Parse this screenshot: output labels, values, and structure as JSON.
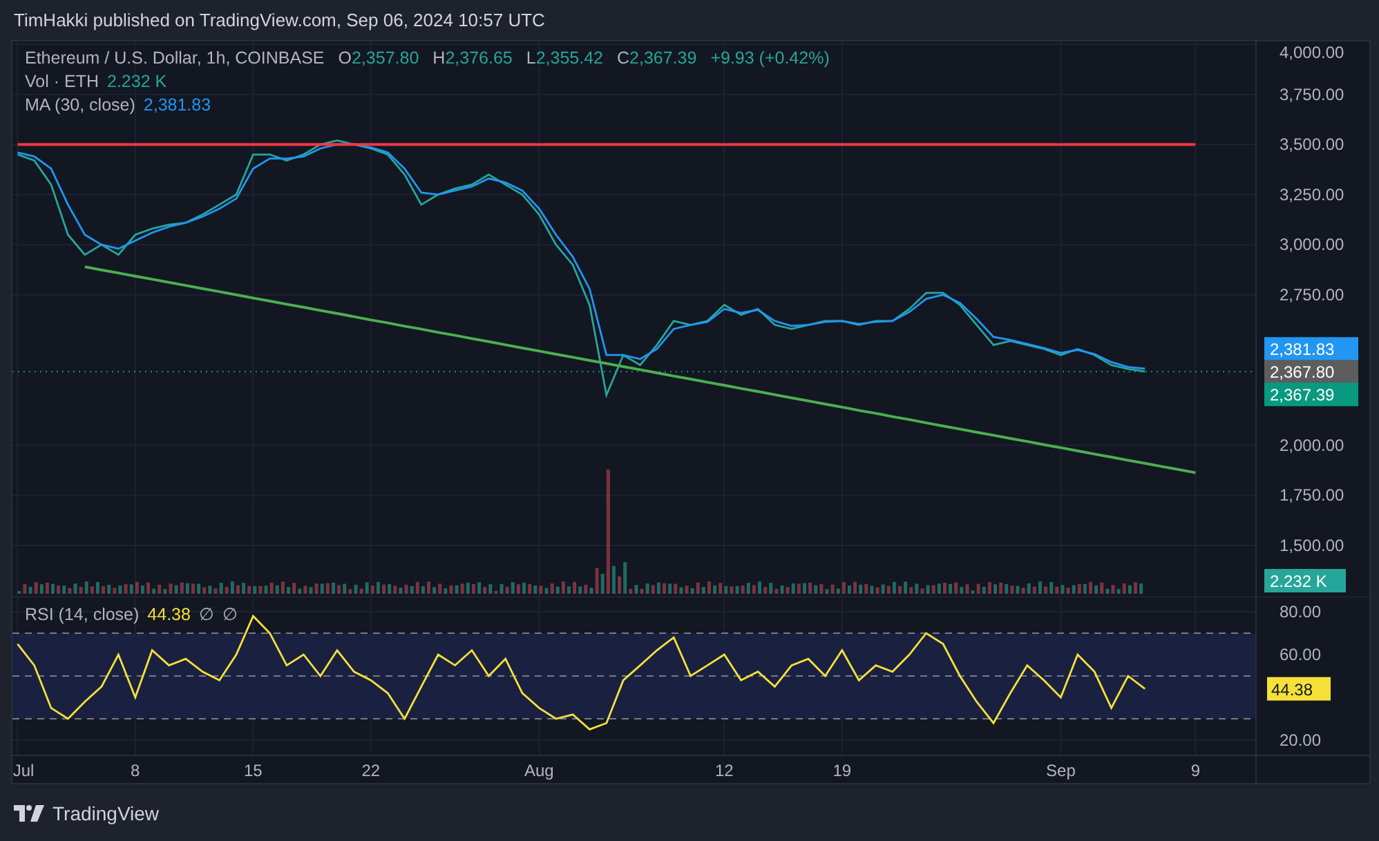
{
  "header": {
    "text": "TimHakki published on TradingView.com, Sep 06, 2024 10:57 UTC"
  },
  "legend": {
    "ohlc": [
      {
        "key": "O",
        "value": "2,357.80"
      },
      {
        "key": "H",
        "value": "2,376.65"
      },
      {
        "key": "L",
        "value": "2,355.42"
      },
      {
        "key": "C",
        "value": "2,367.39"
      }
    ],
    "change": "+9.93 (+0.42%)",
    "volume_label": "Vol · ETH",
    "volume_value": "2.232 K",
    "ma_value": "2,381.83"
  },
  "price_chart": {
    "chart_data": {
      "type": "line",
      "grid": true,
      "ylim": [
        1259,
        4014
      ],
      "yticks": [
        {
          "value": 4000,
          "label": "4,000.00"
        },
        {
          "value": 3750,
          "label": "3,750.00"
        },
        {
          "value": 3500,
          "label": "3,500.00"
        },
        {
          "value": 3250,
          "label": "3,250.00"
        },
        {
          "value": 3000,
          "label": "3,000.00"
        },
        {
          "value": 2750,
          "label": "2,750.00"
        },
        {
          "value": 2000,
          "label": "2,000.00"
        },
        {
          "value": 1750,
          "label": "1,750.00"
        },
        {
          "value": 1500,
          "label": "1,500.00"
        }
      ],
      "series": [
        {
          "name": "Ethereum / U.S. Dollar, 1h, COINBASE",
          "color": "#26a69a",
          "values": [
            3450,
            3420,
            3300,
            3050,
            2950,
            3000,
            2950,
            3050,
            3080,
            3100,
            3110,
            3150,
            3200,
            3250,
            3450,
            3450,
            3420,
            3450,
            3500,
            3520,
            3500,
            3480,
            3450,
            3350,
            3200,
            3250,
            3280,
            3300,
            3350,
            3300,
            3250,
            3150,
            3000,
            2900,
            2700,
            2250,
            2450,
            2400,
            2500,
            2620,
            2600,
            2620,
            2700,
            2650,
            2680,
            2600,
            2580,
            2600,
            2620,
            2620,
            2600,
            2620,
            2620,
            2680,
            2760,
            2760,
            2700,
            2600,
            2500,
            2520,
            2500,
            2480,
            2450,
            2480,
            2450,
            2400,
            2380,
            2367
          ]
        },
        {
          "name": "MA (30, close)",
          "color": "#2196f3",
          "values": [
            3460,
            3440,
            3380,
            3200,
            3050,
            3000,
            2980,
            3020,
            3060,
            3090,
            3110,
            3140,
            3180,
            3230,
            3380,
            3430,
            3430,
            3440,
            3480,
            3500,
            3500,
            3485,
            3460,
            3380,
            3260,
            3250,
            3270,
            3290,
            3330,
            3310,
            3270,
            3180,
            3050,
            2940,
            2780,
            2450,
            2450,
            2430,
            2480,
            2580,
            2600,
            2615,
            2680,
            2660,
            2675,
            2620,
            2595,
            2600,
            2615,
            2620,
            2605,
            2615,
            2620,
            2665,
            2730,
            2750,
            2710,
            2630,
            2540,
            2525,
            2505,
            2485,
            2460,
            2475,
            2455,
            2415,
            2390,
            2382
          ]
        },
        {
          "color": "#f23645",
          "values": [
            3500,
            3500,
            3500,
            3500,
            3500,
            3500,
            3500,
            3500,
            3500,
            3500,
            3500,
            3500,
            3500,
            3500,
            3500,
            3500,
            3500,
            3500,
            3500,
            3500,
            3500,
            3500,
            3500,
            3500,
            3500,
            3500,
            3500,
            3500,
            3500,
            3500,
            3500,
            3500,
            3500,
            3500,
            3500,
            3500,
            3500,
            3500,
            3500,
            3500,
            3500,
            3500,
            3500,
            3500,
            3500,
            3500,
            3500,
            3500,
            3500,
            3500,
            3500,
            3500,
            3500,
            3500,
            3500,
            3500,
            3500,
            3500,
            3500,
            3500,
            3500,
            3500,
            3500,
            3500,
            3500,
            3500,
            3500,
            3500,
            3500,
            3500,
            3500
          ]
        },
        {
          "color": "#4caf50",
          "values": [
            null,
            null,
            null,
            null,
            2890,
            2874,
            2859,
            2843,
            2828,
            2812,
            2797,
            2781,
            2766,
            2750,
            2734,
            2719,
            2703,
            2688,
            2672,
            2657,
            2641,
            2625,
            2610,
            2594,
            2579,
            2563,
            2548,
            2532,
            2517,
            2501,
            2485,
            2470,
            2454,
            2439,
            2423,
            2408,
            2392,
            2377,
            2361,
            2345,
            2330,
            2314,
            2299,
            2283,
            2268,
            2252,
            2236,
            2221,
            2205,
            2190,
            2174,
            2159,
            2143,
            2128,
            2112,
            2096,
            2081,
            2065,
            2050,
            2034,
            2019,
            2003,
            1988,
            1972,
            1956,
            1941,
            1925,
            1910,
            1894,
            1879,
            1863
          ]
        }
      ],
      "ref_lines": [
        {
          "axis": "y",
          "value": 2367,
          "color": "#089981"
        }
      ]
    }
  },
  "price_tags": [
    {
      "text": "2,381.83",
      "color": "#2196f3"
    },
    {
      "text": "2,367.80",
      "color": "#5d5d5d"
    },
    {
      "text": "2,367.39",
      "color": "#089981"
    }
  ],
  "volume_tag": {
    "text": "2.232 K"
  },
  "rsi": {
    "value": "44.38",
    "extras": [
      "∅",
      "∅"
    ],
    "tag": "44.38",
    "chart_data": {
      "type": "line",
      "grid": true,
      "categories": [
        "Jul",
        null,
        null,
        null,
        null,
        null,
        null,
        "8",
        null,
        null,
        null,
        null,
        null,
        null,
        "15",
        null,
        null,
        null,
        null,
        null,
        null,
        "22",
        null,
        null,
        null,
        null,
        null,
        null,
        null,
        null,
        null,
        "Aug",
        null,
        null,
        null,
        null,
        null,
        null,
        null,
        null,
        null,
        null,
        "12",
        null,
        null,
        null,
        null,
        null,
        null,
        "19",
        null,
        null,
        null,
        null,
        null,
        null,
        null,
        null,
        null,
        null,
        null,
        null,
        "Sep",
        null,
        null,
        null,
        null,
        null,
        null,
        null,
        "9"
      ],
      "ylim": [
        12.9,
        87.1
      ],
      "yticks": [
        {
          "value": 80,
          "label": "80.00"
        },
        {
          "value": 60,
          "label": "60.00"
        },
        {
          "value": 20,
          "label": "20.00"
        }
      ],
      "series": [
        {
          "name": "RSI (14, close)",
          "color": "#f5e13a",
          "values": [
            65,
            55,
            35,
            30,
            38,
            45,
            60,
            40,
            62,
            55,
            58,
            52,
            48,
            60,
            78,
            70,
            55,
            60,
            50,
            62,
            52,
            48,
            42,
            30,
            45,
            60,
            55,
            62,
            50,
            58,
            42,
            35,
            30,
            32,
            25,
            28,
            48,
            55,
            62,
            68,
            50,
            55,
            60,
            48,
            52,
            45,
            55,
            58,
            50,
            62,
            48,
            55,
            52,
            60,
            70,
            65,
            50,
            38,
            28,
            42,
            55,
            48,
            40,
            60,
            52,
            35,
            50,
            44,
            null,
            null,
            null
          ]
        }
      ]
    }
  },
  "footer": {
    "brand": "TradingView"
  }
}
